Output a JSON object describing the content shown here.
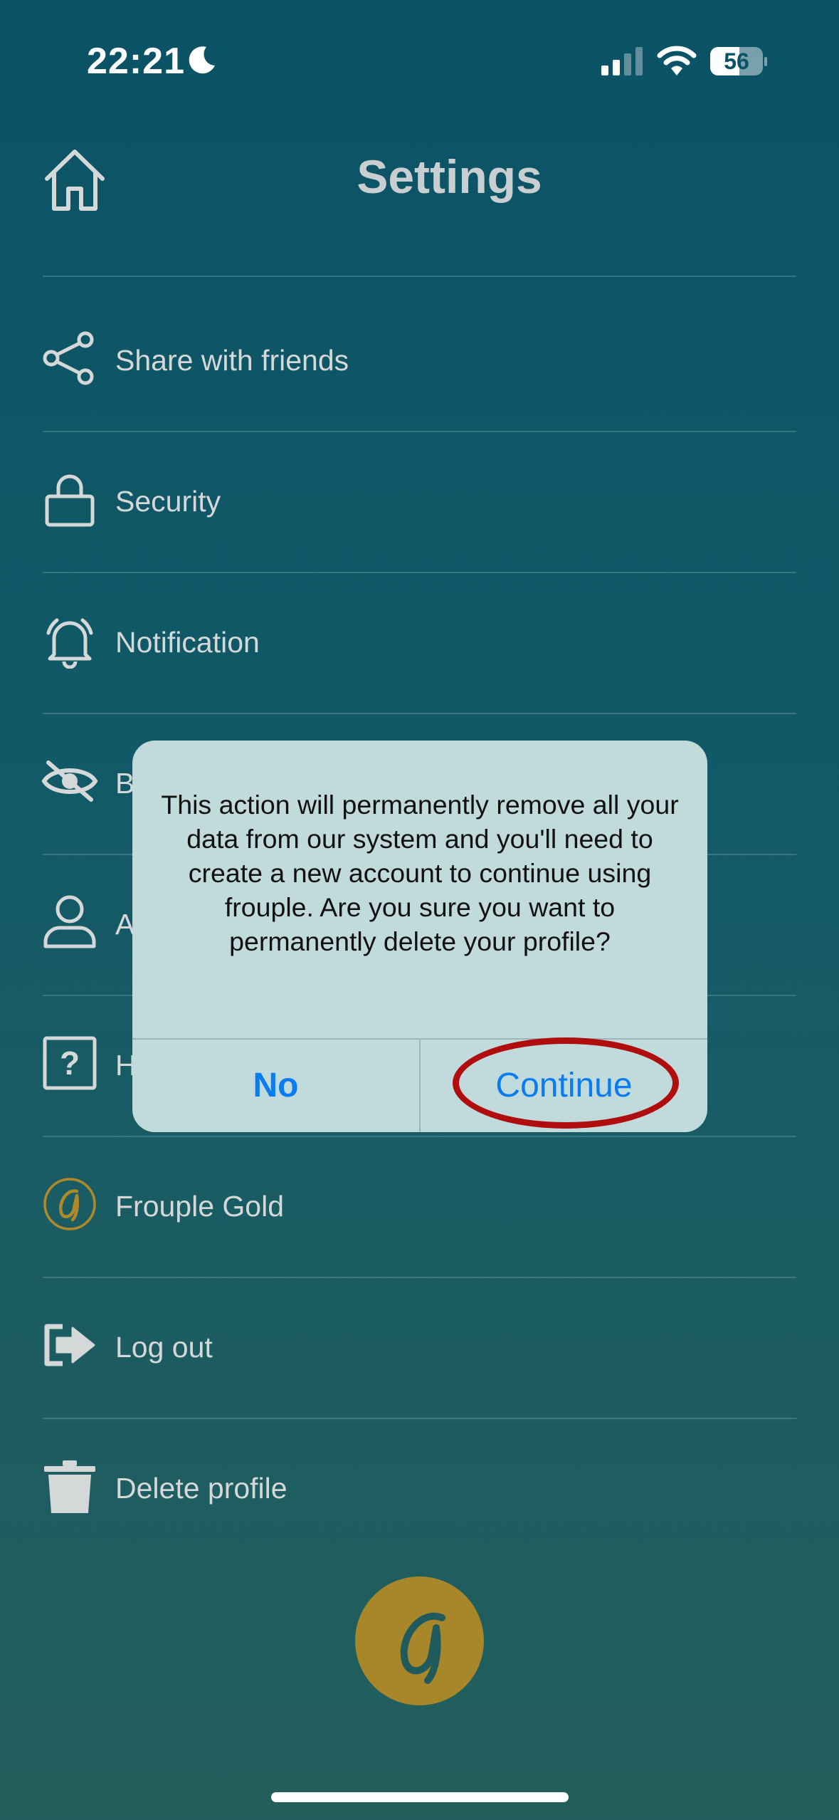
{
  "status_bar": {
    "time": "22:21",
    "battery": "56",
    "battery_level": 0.56
  },
  "header": {
    "title": "Settings"
  },
  "settings": {
    "items": [
      {
        "label": "Share with friends"
      },
      {
        "label": "Security"
      },
      {
        "label": "Notification"
      },
      {
        "label": "Bl"
      },
      {
        "label": "A"
      },
      {
        "label": "H"
      },
      {
        "label": "Frouple Gold"
      },
      {
        "label": "Log out"
      },
      {
        "label": "Delete profile"
      }
    ]
  },
  "dialog": {
    "message": "This action will permanently remove all your data from our system and you'll need to create a new account to continue using frouple. Are you sure you want to permanently delete your profile?",
    "no_label": "No",
    "continue_label": "Continue"
  },
  "colors": {
    "accent_blue": "#0a7cf2",
    "gold": "#a78729",
    "highlight_red": "#b00e0e"
  }
}
